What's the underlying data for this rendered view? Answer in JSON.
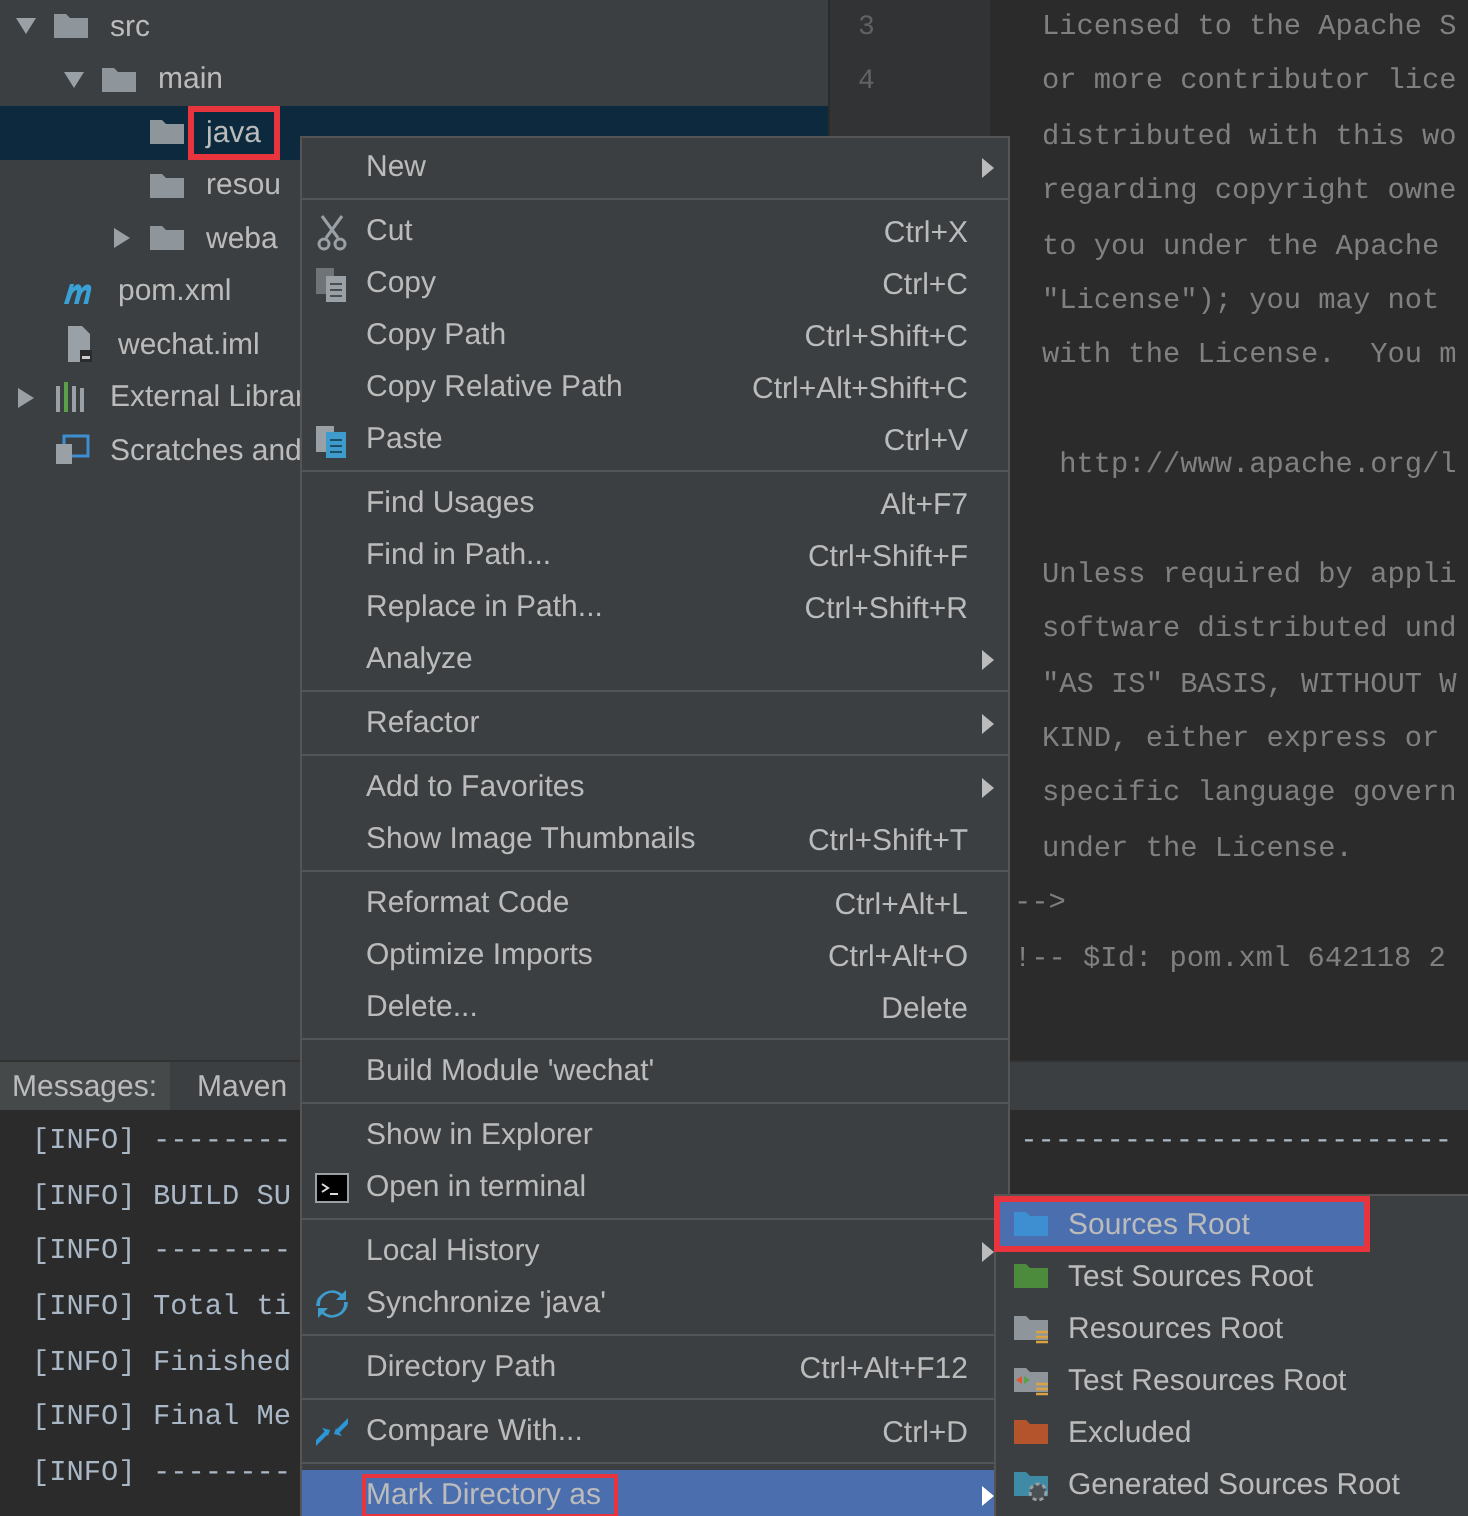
{
  "project_tree": {
    "items": [
      {
        "label": "src",
        "kind": "folder",
        "expanded": true,
        "selected": false,
        "annotated": false,
        "children": [
          {
            "label": "main",
            "kind": "folder",
            "expanded": true,
            "selected": false,
            "annotated": false,
            "children": [
              {
                "label": "java",
                "kind": "folder",
                "selected": true,
                "annotated": true
              },
              {
                "label": "resou",
                "kind": "folder",
                "selected": false,
                "annotated": false
              },
              {
                "label": "weba",
                "kind": "folder",
                "expanded": false,
                "selected": false,
                "annotated": false
              }
            ]
          }
        ]
      },
      {
        "label": "pom.xml",
        "kind": "maven",
        "selected": false,
        "annotated": false,
        "depth_pad": true
      },
      {
        "label": "wechat.iml",
        "kind": "file",
        "selected": false,
        "annotated": false,
        "depth_pad": true
      },
      {
        "label": "External Librar",
        "kind": "library",
        "expanded": false,
        "selected": false,
        "annotated": false
      },
      {
        "label": "Scratches and",
        "kind": "scratch",
        "selected": false,
        "annotated": false
      }
    ]
  },
  "editor": {
    "paragraphs": [
      [
        {
          "number": "3",
          "text": "Licensed to the Apache S"
        },
        {
          "number": "4",
          "text": "or more contributor lice"
        },
        {
          "text": "distributed with this wo"
        },
        {
          "text": "regarding copyright owne"
        },
        {
          "text": "to you under the Apache"
        },
        {
          "text": "\"License\"); you may not"
        },
        {
          "text": "with the License.  You m"
        }
      ],
      [
        {
          "text": " http://www.apache.org/l"
        }
      ],
      [
        {
          "text": "Unless required by appli"
        },
        {
          "text": "software distributed und"
        },
        {
          "text": "\"AS IS\" BASIS, WITHOUT W"
        },
        {
          "text": "KIND, either express or"
        },
        {
          "text": "specific language govern"
        },
        {
          "text": "under the License."
        },
        {
          "text": "-->",
          "outdent": true
        },
        {
          "text": "!-- $Id: pom.xml 642118 2",
          "outdent": true
        }
      ]
    ]
  },
  "bottom_panel": {
    "tabs": [
      {
        "label": "Messages:"
      },
      {
        "label": "Maven"
      }
    ],
    "console": [
      {
        "text": "[INFO] --------",
        "tail": "-------------------------"
      },
      {
        "text": "[INFO] BUILD SU"
      },
      {
        "text": "[INFO] --------"
      },
      {
        "text": "[INFO] Total ti"
      },
      {
        "text": "[INFO] Finished"
      },
      {
        "text": "[INFO] Final Me"
      },
      {
        "text": "[INFO] --------"
      }
    ]
  },
  "context_menu": {
    "groups": [
      [
        {
          "label": "New",
          "submenu": true,
          "selected": false,
          "annotated": false
        }
      ],
      [
        {
          "label": "Cut",
          "shortcut": "Ctrl+X",
          "kind": "scissors",
          "selected": false,
          "annotated": false
        },
        {
          "label": "Copy",
          "shortcut": "Ctrl+C",
          "kind": "copy",
          "selected": false,
          "annotated": false
        },
        {
          "label": "Copy Path",
          "shortcut": "Ctrl+Shift+C",
          "selected": false,
          "annotated": false
        },
        {
          "label": "Copy Relative Path",
          "shortcut": "Ctrl+Alt+Shift+C",
          "selected": false,
          "annotated": false
        },
        {
          "label": "Paste",
          "shortcut": "Ctrl+V",
          "kind": "paste",
          "selected": false,
          "annotated": false
        }
      ],
      [
        {
          "label": "Find Usages",
          "shortcut": "Alt+F7",
          "selected": false,
          "annotated": false
        },
        {
          "label": "Find in Path...",
          "shortcut": "Ctrl+Shift+F",
          "selected": false,
          "annotated": false
        },
        {
          "label": "Replace in Path...",
          "shortcut": "Ctrl+Shift+R",
          "selected": false,
          "annotated": false
        },
        {
          "label": "Analyze",
          "submenu": true,
          "selected": false,
          "annotated": false
        }
      ],
      [
        {
          "label": "Refactor",
          "submenu": true,
          "selected": false,
          "annotated": false
        }
      ],
      [
        {
          "label": "Add to Favorites",
          "submenu": true,
          "selected": false,
          "annotated": false
        },
        {
          "label": "Show Image Thumbnails",
          "shortcut": "Ctrl+Shift+T",
          "selected": false,
          "annotated": false
        }
      ],
      [
        {
          "label": "Reformat Code",
          "shortcut": "Ctrl+Alt+L",
          "selected": false,
          "annotated": false
        },
        {
          "label": "Optimize Imports",
          "shortcut": "Ctrl+Alt+O",
          "selected": false,
          "annotated": false
        },
        {
          "label": "Delete...",
          "shortcut": "Delete",
          "selected": false,
          "annotated": false
        }
      ],
      [
        {
          "label": "Build Module 'wechat'",
          "selected": false,
          "annotated": false
        }
      ],
      [
        {
          "label": "Show in Explorer",
          "selected": false,
          "annotated": false
        },
        {
          "label": "Open in terminal",
          "kind": "terminal",
          "selected": false,
          "annotated": false
        }
      ],
      [
        {
          "label": "Local History",
          "submenu": true,
          "selected": false,
          "annotated": false
        },
        {
          "label": "Synchronize 'java'",
          "kind": "sync",
          "selected": false,
          "annotated": false
        }
      ],
      [
        {
          "label": "Directory Path",
          "shortcut": "Ctrl+Alt+F12",
          "selected": false,
          "annotated": false
        }
      ],
      [
        {
          "label": "Compare With...",
          "shortcut": "Ctrl+D",
          "kind": "compare",
          "selected": false,
          "annotated": false
        }
      ],
      [
        {
          "label": "Mark Directory as",
          "submenu": true,
          "selected": true,
          "annotated": true
        }
      ]
    ]
  },
  "submenu": {
    "items": [
      {
        "label": "Sources Root",
        "kind": "plain",
        "color": "#3d8fd1",
        "selected": true,
        "annotated": true
      },
      {
        "label": "Test Sources Root",
        "kind": "plain",
        "color": "#4c8a3c",
        "selected": false,
        "annotated": false
      },
      {
        "label": "Resources Root",
        "kind": "lines",
        "color": "#8e969c",
        "selected": false,
        "annotated": false
      },
      {
        "label": "Test Resources Root",
        "kind": "arrows",
        "color": "#8e969c",
        "selected": false,
        "annotated": false
      },
      {
        "label": "Excluded",
        "kind": "plain",
        "color": "#b4542c",
        "selected": false,
        "annotated": false
      },
      {
        "label": "Generated Sources Root",
        "kind": "gear",
        "color": "#3f8aa5",
        "selected": false,
        "annotated": false
      }
    ]
  }
}
